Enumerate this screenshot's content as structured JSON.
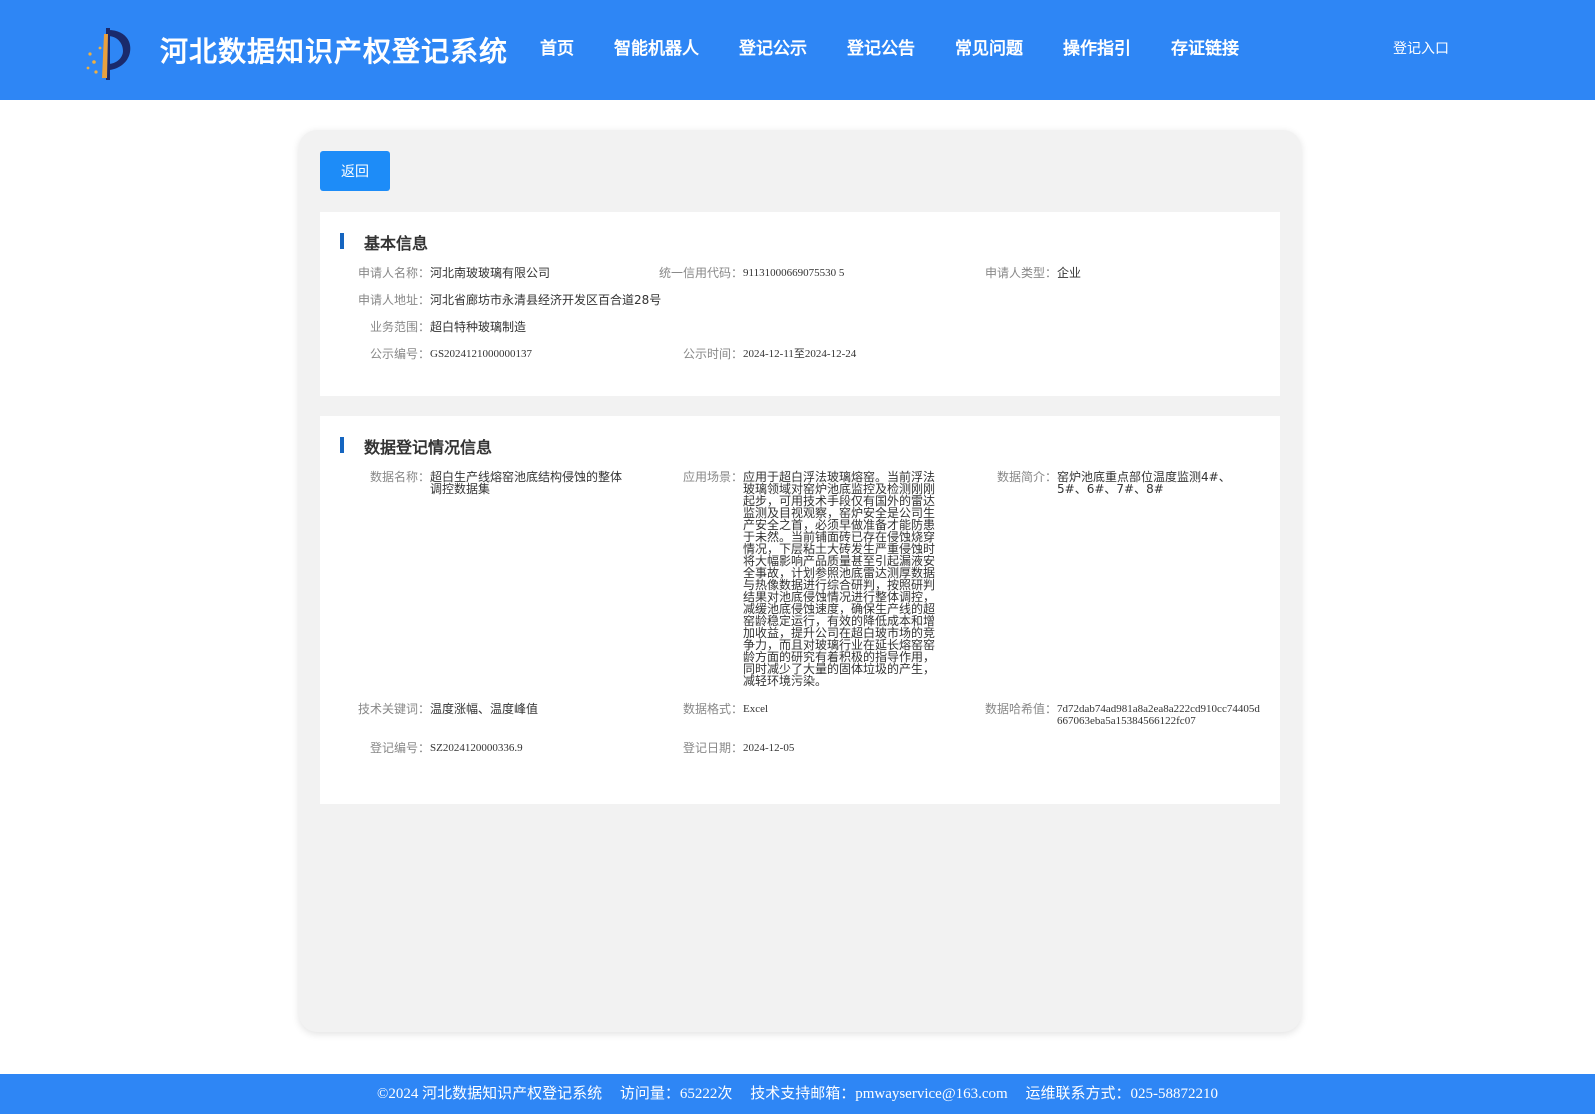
{
  "header": {
    "site_title": "河北数据知识产权登记系统",
    "nav": [
      "首页",
      "智能机器人",
      "登记公示",
      "登记公告",
      "常见问题",
      "操作指引",
      "存证链接"
    ],
    "login": "登记入口"
  },
  "back_button": "返回",
  "basic_info": {
    "title": "基本信息",
    "applicant_name_label": "申请人名称：",
    "applicant_name": "河北南玻玻璃有限公司",
    "credit_code_label": "统一信用代码：",
    "credit_code": "91131000669075530 5",
    "applicant_type_label": "申请人类型：",
    "applicant_type": "企业",
    "address_label": "申请人地址：",
    "address": "河北省廊坊市永清县经济开发区百合道28号",
    "scope_label": "业务范围：",
    "scope": "超白特种玻璃制造",
    "notice_no_label": "公示编号：",
    "notice_no": "GS2024121000000137",
    "notice_time_label": "公示时间：",
    "notice_time": "2024-12-11至2024-12-24"
  },
  "data_info": {
    "title": "数据登记情况信息",
    "data_name_label": "数据名称：",
    "data_name": "超白生产线熔窑池底结构侵蚀的整体调控数据集",
    "scenario_label": "应用场景：",
    "scenario": "应用于超白浮法玻璃熔窑。当前浮法玻璃领域对窑炉池底监控及检测刚刚起步，可用技术手段仅有国外的雷达监测及目视观察，窑炉安全是公司生产安全之首，必须早做准备才能防患于未然。当前铺面砖已存在侵蚀烧穿情况，下层粘土大砖发生严重侵蚀时将大幅影响产品质量甚至引起漏液安全事故，计划参照池底雷达测厚数据与热像数据进行综合研判，按照研判结果对池底侵蚀情况进行整体调控，减缓池底侵蚀速度，确保生产线的超窑龄稳定运行，有效的降低成本和增加收益，提升公司在超白玻市场的竞争力，而且对玻璃行业在延长熔窑窑龄方面的研究有着积极的指导作用，同时减少了大量的固体垃圾的产生，减轻环境污染。",
    "summary_label": "数据简介：",
    "summary": "窑炉池底重点部位温度监测4#、5#、6#、7#、8#",
    "keywords_label": "技术关键词：",
    "keywords": "温度涨幅、温度峰值",
    "format_label": "数据格式：",
    "format": "Excel",
    "hash_label": "数据哈希值：",
    "hash": "7d72dab74ad981a8a2ea8a222cd910cc74405d667063eba5a15384566122fc07",
    "reg_no_label": "登记编号：",
    "reg_no": "SZ2024120000336.9",
    "reg_date_label": "登记日期：",
    "reg_date": "2024-12-05"
  },
  "footer": {
    "copyright": "©2024 河北数据知识产权登记系统",
    "visits": "访问量：65222次",
    "email": "技术支持邮箱：pmwayservice@163.com",
    "phone": "运维联系方式：025-58872210"
  },
  "colors": {
    "header_bg": "#2e86f5",
    "button_bg": "#1d8cf8",
    "section_bar": "#1565c0"
  }
}
